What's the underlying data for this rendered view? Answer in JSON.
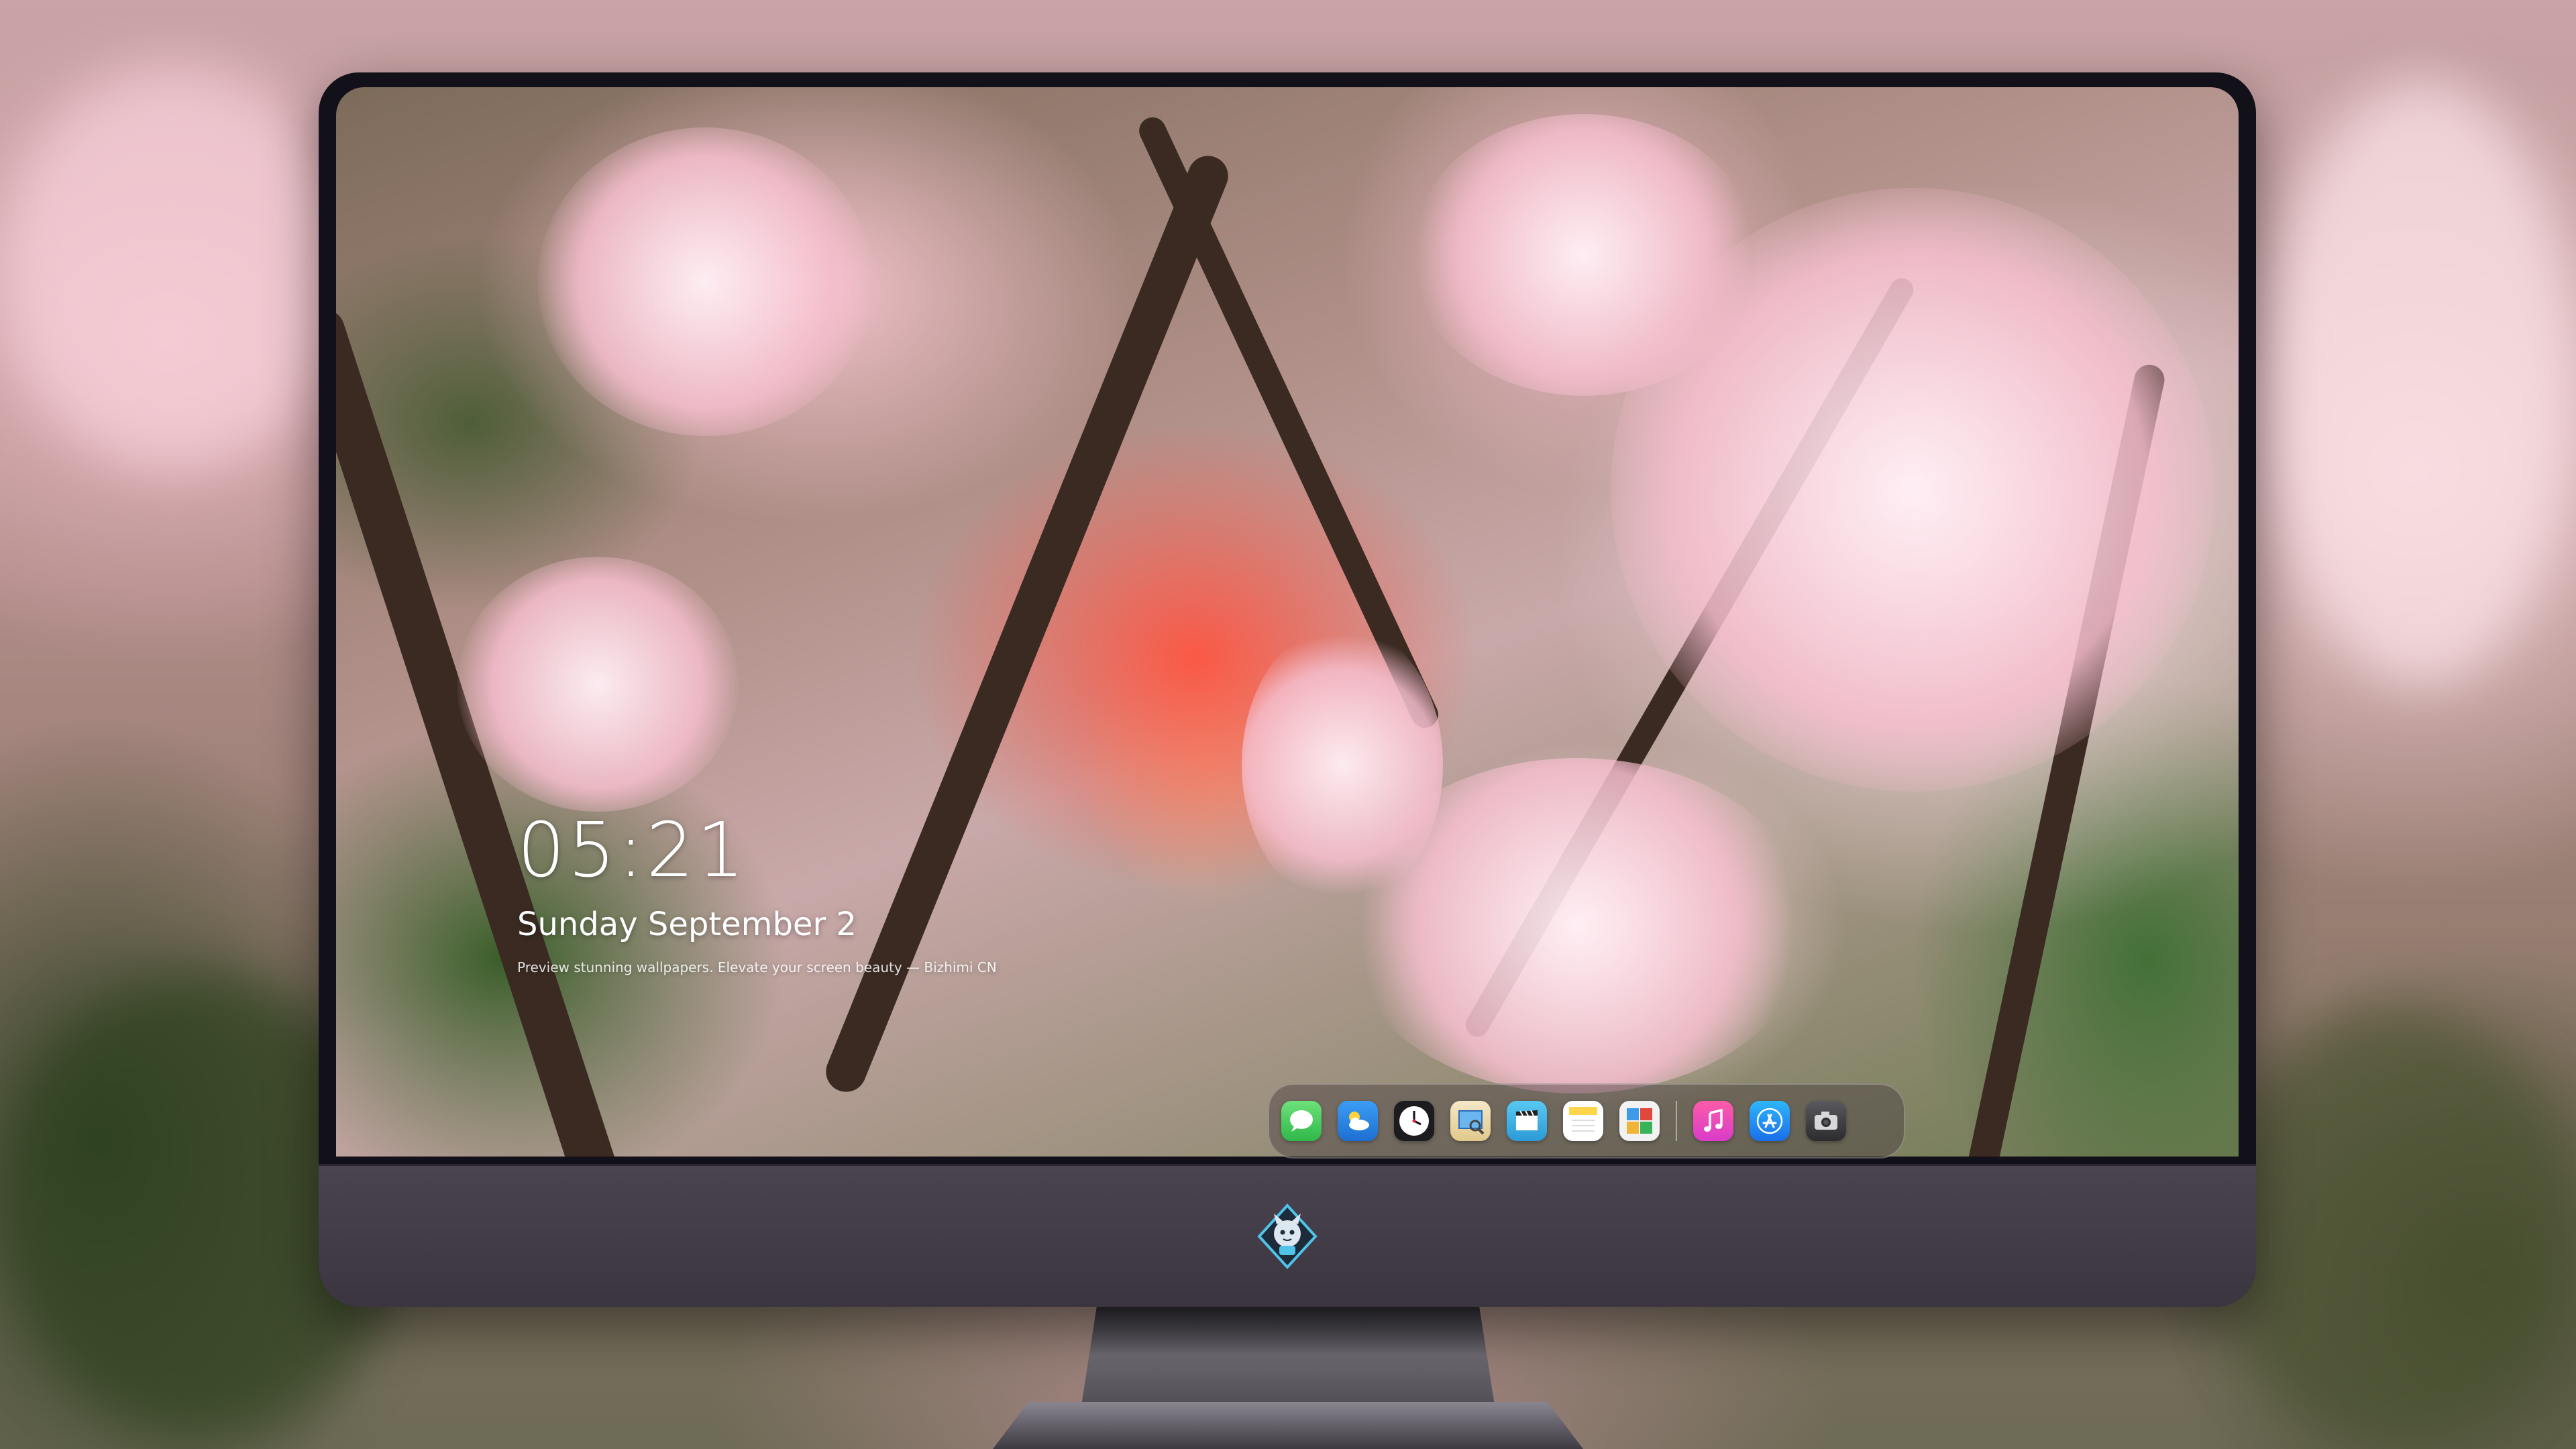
{
  "lockscreen": {
    "time": "05:21",
    "date": "Sunday September  2",
    "tagline": "Preview stunning wallpapers. Elevate your screen beauty — Bizhimi CN"
  },
  "dock": {
    "apps": [
      {
        "name": "Messages",
        "icon": "messages-icon",
        "color": "#34c759"
      },
      {
        "name": "Weather",
        "icon": "weather-icon",
        "color": "#2f86e8"
      },
      {
        "name": "Clock",
        "icon": "clock-icon",
        "color": "#1c1c1e"
      },
      {
        "name": "Preview",
        "icon": "preview-icon",
        "color": "#e8b93c"
      },
      {
        "name": "Clips",
        "icon": "clips-icon",
        "color": "#4fb3e8"
      },
      {
        "name": "Notes",
        "icon": "notes-icon",
        "color": "#ffd54a"
      },
      {
        "name": "Photo Booth",
        "icon": "photo-booth-icon",
        "color": "#e0483b"
      },
      {
        "name": "Music",
        "icon": "music-icon",
        "color": "#f3468e"
      },
      {
        "name": "App Store",
        "icon": "app-store-icon",
        "color": "#1e8ef7"
      },
      {
        "name": "Camera",
        "icon": "camera-icon",
        "color": "#3a3a3c"
      }
    ]
  },
  "monitor": {
    "logo": "mascot-logo-icon"
  }
}
